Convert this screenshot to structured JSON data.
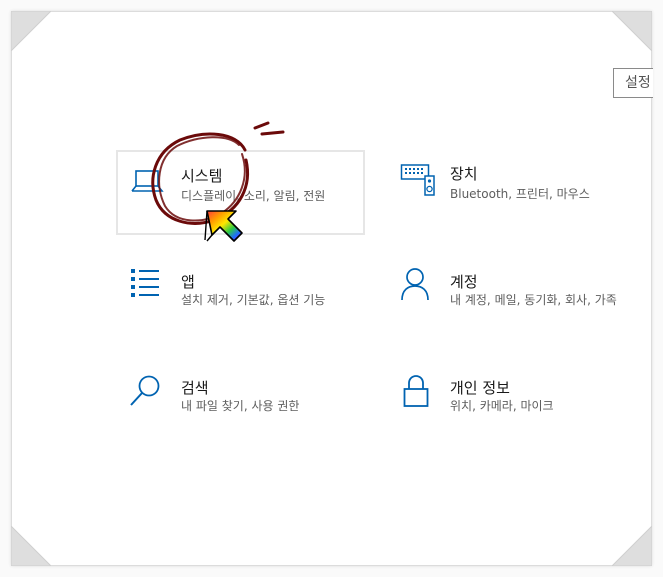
{
  "settings_tag": "설정",
  "accent_color": "#0063b1",
  "annotation_color": "#6b0a0a",
  "tiles": [
    {
      "title": "시스템",
      "description": "디스플레이, 소리, 알림, 전원",
      "icon": "laptop-icon"
    },
    {
      "title": "장치",
      "description": "Bluetooth, 프린터, 마우스",
      "icon": "keyboard-speaker-icon"
    },
    {
      "title": "앱",
      "description": "설치 제거, 기본값, 옵션 기능",
      "icon": "app-list-icon"
    },
    {
      "title": "계정",
      "description": "내 계정, 메일, 동기화, 회사, 가족",
      "icon": "person-icon"
    },
    {
      "title": "검색",
      "description": "내 파일 찾기, 사용 권한",
      "icon": "search-icon"
    },
    {
      "title": "개인 정보",
      "description": "위치, 카메라, 마이크",
      "icon": "lock-icon"
    }
  ]
}
